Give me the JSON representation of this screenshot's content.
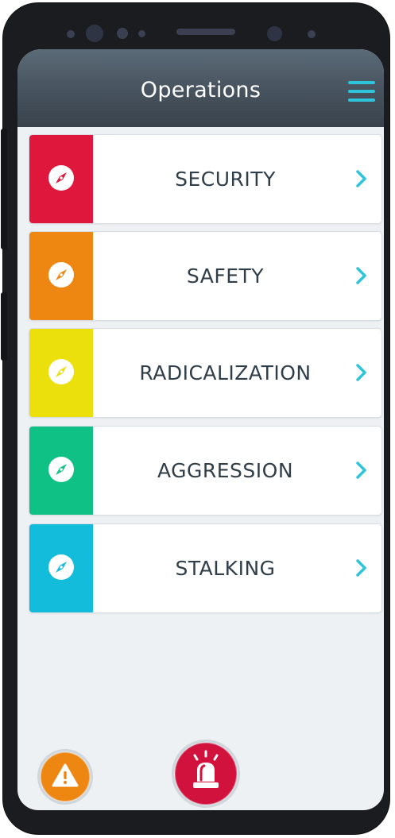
{
  "header": {
    "title": "Operations",
    "accent_color": "#2ec4dc",
    "menu_icon": "hamburger-menu-icon"
  },
  "categories": [
    {
      "label": "SECURITY",
      "color": "#e0173d",
      "icon": "compass-icon"
    },
    {
      "label": "SAFETY",
      "color": "#ee8612",
      "icon": "compass-icon"
    },
    {
      "label": "RADICALIZATION",
      "color": "#ebdf0c",
      "icon": "compass-icon"
    },
    {
      "label": "AGGRESSION",
      "color": "#10c185",
      "icon": "compass-icon"
    },
    {
      "label": "STALKING",
      "color": "#13bcdb",
      "icon": "compass-icon"
    }
  ],
  "footer": {
    "warning_button": {
      "icon": "warning-icon",
      "color": "#ee8612"
    },
    "alarm_button": {
      "icon": "siren-icon",
      "color": "#d0123d"
    }
  }
}
